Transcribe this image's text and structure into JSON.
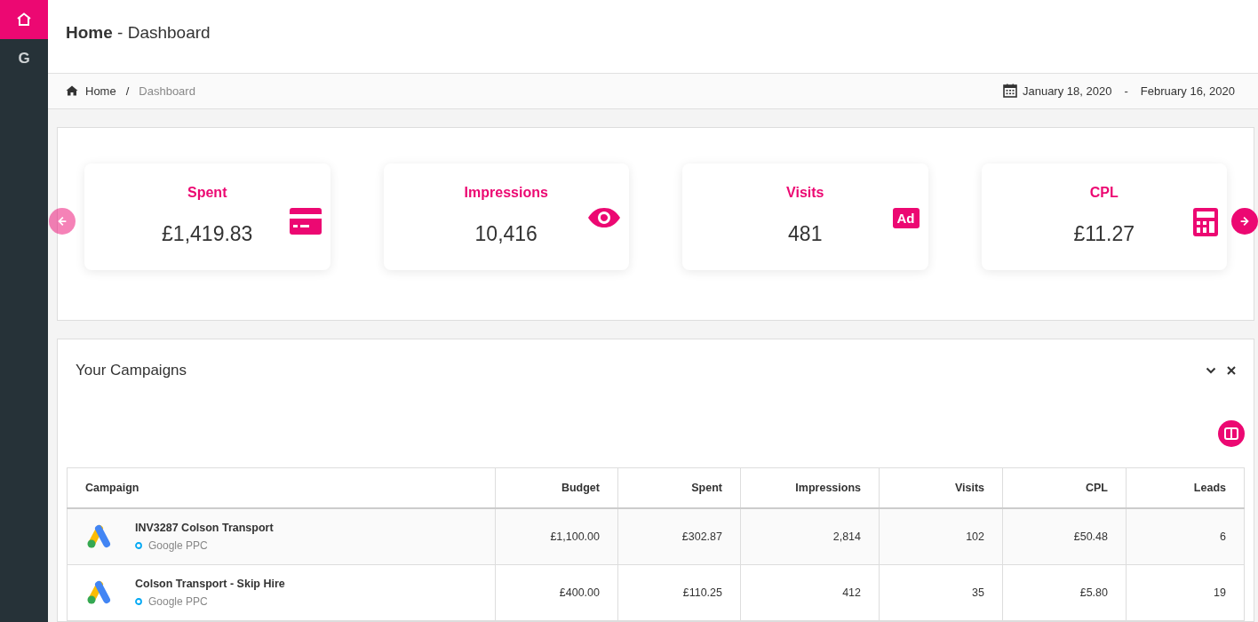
{
  "sidebar": {
    "items": [
      {
        "kind": "home",
        "selected": true
      },
      {
        "kind": "letter",
        "label": "G",
        "selected": false
      }
    ]
  },
  "header": {
    "title": "**Home** - Dashboard"
  },
  "breadcrumb": {
    "items": [
      {
        "label": "Home",
        "current": false
      },
      {
        "label": "Dashboard",
        "current": true
      }
    ],
    "separator": "/",
    "date_from": "January 18, 2020",
    "date_separator": "-",
    "date_to": "February 16, 2020"
  },
  "stats": {
    "prev": {
      "disabled": true
    },
    "next": {
      "disabled": false
    },
    "cards": [
      {
        "title": "Spent",
        "value": "£1,419.83",
        "kind": "credit-card"
      },
      {
        "title": "Impressions",
        "value": "10,416",
        "kind": "eye"
      },
      {
        "title": "Visits",
        "value": "481",
        "kind": "badge",
        "icon_label": "Ad"
      },
      {
        "title": "CPL",
        "value": "£11.27",
        "kind": "calculator"
      }
    ]
  },
  "campaigns": {
    "title": "Your Campaigns",
    "table": {
      "columns": [
        "Campaign",
        "Budget",
        "Spent",
        "Impressions",
        "Visits",
        "CPL",
        "Leads"
      ],
      "rows": [
        {
          "cells": [
            {
              "name": "INV3287 Colson Transport",
              "source": "Google PPC"
            },
            "£1,100.00",
            "£302.87",
            "2,814",
            "102",
            "£50.48",
            "6"
          ]
        },
        {
          "cells": [
            {
              "name": "Colson Transport - Skip Hire",
              "source": "Google PPC"
            },
            "£400.00",
            "£110.25",
            "412",
            "35",
            "£5.80",
            "19"
          ]
        }
      ]
    }
  }
}
